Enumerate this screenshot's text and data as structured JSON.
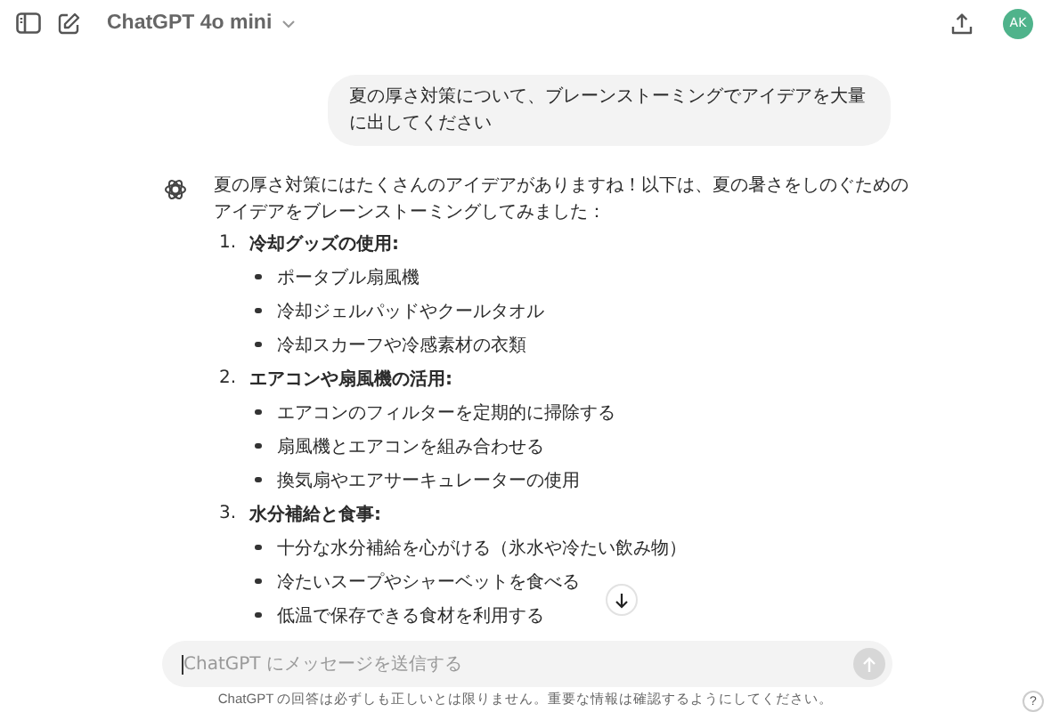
{
  "header": {
    "model": "ChatGPT 4o mini",
    "avatar": "AK"
  },
  "user_message": "夏の厚さ対策について、ブレーンストーミングでアイデアを大量に出してください",
  "assistant": {
    "intro": "夏の厚さ対策にはたくさんのアイデアがありますね！以下は、夏の暑さをしのぐためのアイデアをブレーンストーミングしてみました：",
    "sections": [
      {
        "number": "1.",
        "title": "冷却グッズの使用:",
        "items": [
          "ポータブル扇風機",
          "冷却ジェルパッドやクールタオル",
          "冷却スカーフや冷感素材の衣類"
        ]
      },
      {
        "number": "2.",
        "title": "エアコンや扇風機の活用:",
        "items": [
          "エアコンのフィルターを定期的に掃除する",
          "扇風機とエアコンを組み合わせる",
          "換気扇やエアサーキュレーターの使用"
        ]
      },
      {
        "number": "3.",
        "title": "水分補給と食事:",
        "items": [
          "十分な水分補給を心がける（氷水や冷たい飲み物）",
          "冷たいスープやシャーベットを食べる",
          "低温で保存できる食材を利用する"
        ]
      }
    ]
  },
  "composer": {
    "placeholder": "ChatGPT にメッセージを送信する",
    "send_disabled": true
  },
  "footer": "ChatGPT の回答は必ずしも正しいとは限りません。重要な情報は確認するようにしてください。",
  "help": "?"
}
